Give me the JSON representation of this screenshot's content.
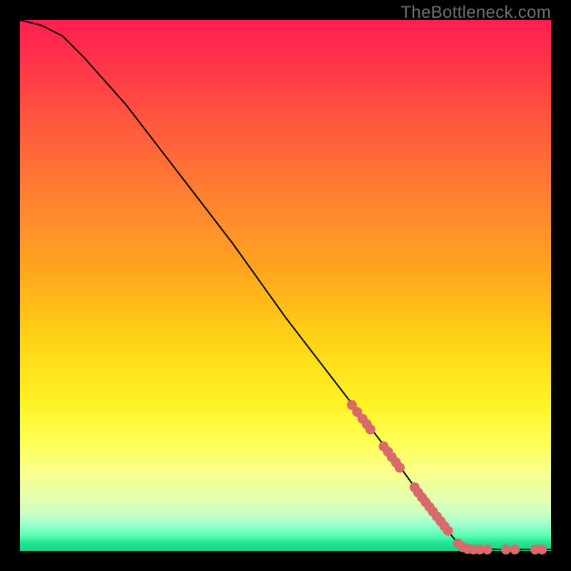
{
  "watermark": "TheBottleneck.com",
  "chart_data": {
    "type": "line",
    "title": "",
    "xlabel": "",
    "ylabel": "",
    "xlim": [
      0,
      100
    ],
    "ylim": [
      0,
      100
    ],
    "curve": [
      {
        "x": 0,
        "y": 100
      },
      {
        "x": 4,
        "y": 99
      },
      {
        "x": 8,
        "y": 97
      },
      {
        "x": 12,
        "y": 93
      },
      {
        "x": 20,
        "y": 84
      },
      {
        "x": 30,
        "y": 71
      },
      {
        "x": 40,
        "y": 58
      },
      {
        "x": 50,
        "y": 44
      },
      {
        "x": 60,
        "y": 31
      },
      {
        "x": 70,
        "y": 18
      },
      {
        "x": 78,
        "y": 7
      },
      {
        "x": 82,
        "y": 2
      },
      {
        "x": 85,
        "y": 0.5
      },
      {
        "x": 90,
        "y": 0.3
      },
      {
        "x": 100,
        "y": 0.3
      }
    ],
    "markers": {
      "color": "#d86a6a",
      "radius_px": 7,
      "points": [
        {
          "x": 62.5,
          "y": 27.5
        },
        {
          "x": 63.5,
          "y": 26.2
        },
        {
          "x": 64.5,
          "y": 24.9
        },
        {
          "x": 65.3,
          "y": 23.9
        },
        {
          "x": 66.0,
          "y": 22.9
        },
        {
          "x": 68.5,
          "y": 19.7
        },
        {
          "x": 69.3,
          "y": 18.7
        },
        {
          "x": 70.0,
          "y": 17.7
        },
        {
          "x": 70.8,
          "y": 16.7
        },
        {
          "x": 71.5,
          "y": 15.7
        },
        {
          "x": 74.3,
          "y": 12.0
        },
        {
          "x": 75.0,
          "y": 11.0
        },
        {
          "x": 75.7,
          "y": 10.1
        },
        {
          "x": 76.4,
          "y": 9.2
        },
        {
          "x": 77.1,
          "y": 8.3
        },
        {
          "x": 77.8,
          "y": 7.4
        },
        {
          "x": 78.5,
          "y": 6.5
        },
        {
          "x": 79.2,
          "y": 5.6
        },
        {
          "x": 79.9,
          "y": 4.7
        },
        {
          "x": 80.6,
          "y": 3.8
        },
        {
          "x": 82.5,
          "y": 1.4
        },
        {
          "x": 83.4,
          "y": 0.7
        },
        {
          "x": 84.3,
          "y": 0.4
        },
        {
          "x": 85.4,
          "y": 0.3
        },
        {
          "x": 86.6,
          "y": 0.3
        },
        {
          "x": 88.0,
          "y": 0.3
        },
        {
          "x": 91.5,
          "y": 0.3
        },
        {
          "x": 93.2,
          "y": 0.3
        },
        {
          "x": 97.0,
          "y": 0.3
        },
        {
          "x": 98.3,
          "y": 0.3
        }
      ]
    }
  }
}
